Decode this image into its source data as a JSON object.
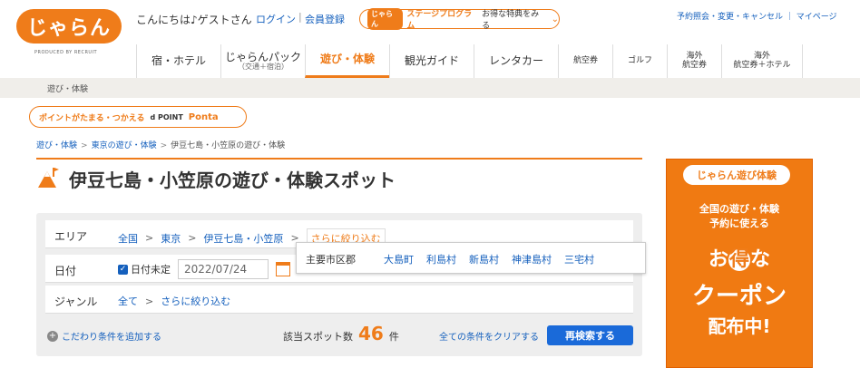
{
  "header": {
    "logo": "じゃらん",
    "logo_sub": "PRODUCED BY RECRUIT",
    "greeting": "こんにちは♪ゲストさん",
    "login": "ログイン",
    "sep": "|",
    "register": "会員登録",
    "stage_logo": "じゃらん",
    "stage_title": "ステージプログラム",
    "stage_sub": "お得な特典をみる",
    "right_links": "予約照会・変更・キャンセル ｜ マイページ"
  },
  "nav": [
    {
      "label": "宿・ホテル",
      "sub": ""
    },
    {
      "label": "じゃらんパック",
      "sub": "（交通＋宿泊）"
    },
    {
      "label": "遊び・体験",
      "sub": ""
    },
    {
      "label": "観光ガイド",
      "sub": ""
    },
    {
      "label": "レンタカー",
      "sub": ""
    },
    {
      "label": "航空券",
      "sub": ""
    },
    {
      "label": "ゴルフ",
      "sub": ""
    },
    {
      "label": "海外",
      "sub": "航空券"
    },
    {
      "label": "海外",
      "sub": "航空券＋ホテル"
    }
  ],
  "band_label": "遊び・体験",
  "points": {
    "text": "ポイントがたまる・つかえる",
    "dpoint": "d POINT",
    "ponta": "Ponta"
  },
  "breadcrumb": [
    "遊び・体験",
    "東京の遊び・体験",
    "伊豆七島・小笠原の遊び・体験"
  ],
  "breadcrumb_sep": ">",
  "page_title": "伊豆七島・小笠原の遊び・体験スポット",
  "search": {
    "area_label": "エリア",
    "area_path": [
      "全国",
      "東京",
      "伊豆七島・小笠原"
    ],
    "narrow": "さらに絞り込む",
    "gt": ">",
    "date_label": "日付",
    "date_undecided": "日付未定",
    "date_value": "2022/07/24",
    "genre_label": "ジャンル",
    "genre_all": "全て",
    "genre_narrow": "さらに絞り込む"
  },
  "dropdown": {
    "label": "主要市区郡",
    "options": [
      "大島町",
      "利島村",
      "新島村",
      "神津島村",
      "三宅村"
    ]
  },
  "footer": {
    "add_condition": "こだわり条件を追加する",
    "count_label": "該当スポット数",
    "count": "46",
    "count_unit": "件",
    "clear": "全ての条件をクリアする",
    "research": "再検索する"
  },
  "ad": {
    "top": "じゃらん遊び体験",
    "line1": "全国の遊び・体験",
    "line2": "予約に使える",
    "line3a": "お",
    "line3b": "得",
    "line3c": "な",
    "line4": "クーポン",
    "line5": "配布中!"
  },
  "colors": {
    "brand": "#ef7c1a",
    "link": "#1560bd",
    "button": "#1a6ad9"
  }
}
